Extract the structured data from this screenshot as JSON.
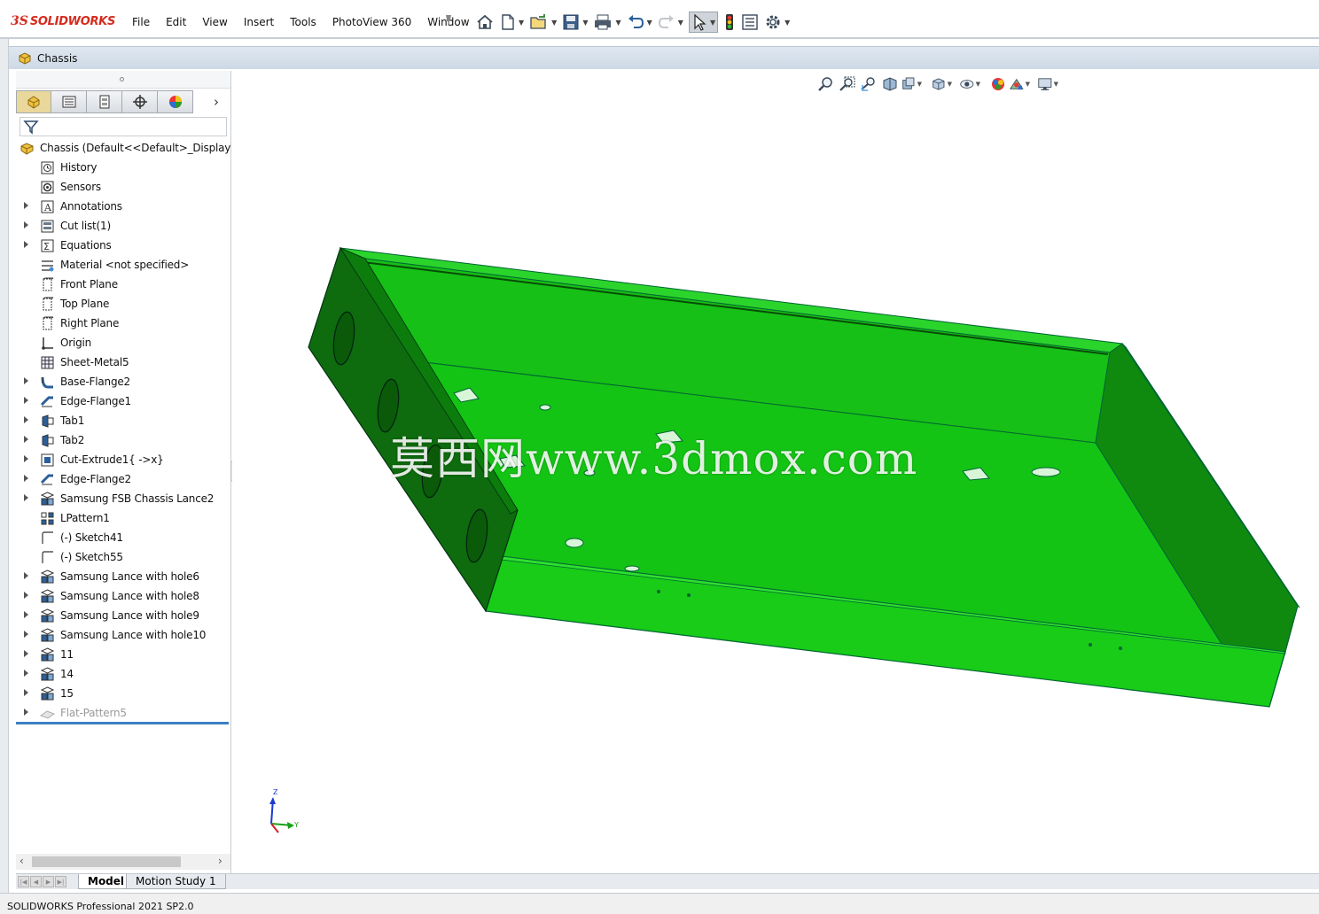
{
  "app": {
    "logo_ds": "3S",
    "logo_name": "SOLIDWORKS",
    "accent_red": "#d52b1e"
  },
  "menubar": {
    "items": [
      "File",
      "Edit",
      "View",
      "Insert",
      "Tools",
      "PhotoView 360",
      "Window"
    ],
    "pin_icon": "pin-icon"
  },
  "toolbar": {
    "icons": [
      "home-icon",
      "new-document-icon",
      "open-icon",
      "save-icon",
      "print-icon",
      "undo-icon",
      "redo-icon",
      "select-icon",
      "rebuild-icon",
      "file-properties-icon",
      "options-icon"
    ]
  },
  "document": {
    "title": "Chassis"
  },
  "feature_manager": {
    "tabs": [
      "featuremanager-tab",
      "propertymanager-tab",
      "configurationmanager-tab",
      "dimxpertmanager-tab",
      "displaymanager-tab"
    ],
    "root_label": "Chassis  (Default<<Default>_Display Stat",
    "items": [
      {
        "label": "History",
        "icon": "history-icon",
        "expand": false
      },
      {
        "label": "Sensors",
        "icon": "sensors-icon",
        "expand": false
      },
      {
        "label": "Annotations",
        "icon": "annotations-icon",
        "expand": true
      },
      {
        "label": "Cut list(1)",
        "icon": "cut-list-icon",
        "expand": true
      },
      {
        "label": "Equations",
        "icon": "equations-icon",
        "expand": true
      },
      {
        "label": "Material <not specified>",
        "icon": "material-icon",
        "expand": false
      },
      {
        "label": "Front Plane",
        "icon": "plane-icon",
        "expand": false
      },
      {
        "label": "Top Plane",
        "icon": "plane-icon",
        "expand": false
      },
      {
        "label": "Right Plane",
        "icon": "plane-icon",
        "expand": false
      },
      {
        "label": "Origin",
        "icon": "origin-icon",
        "expand": false
      },
      {
        "label": "Sheet-Metal5",
        "icon": "sheet-metal-icon",
        "expand": false
      },
      {
        "label": "Base-Flange2",
        "icon": "base-flange-icon",
        "expand": true
      },
      {
        "label": "Edge-Flange1",
        "icon": "edge-flange-icon",
        "expand": true
      },
      {
        "label": "Tab1",
        "icon": "tab-feature-icon",
        "expand": true
      },
      {
        "label": "Tab2",
        "icon": "tab-feature-icon",
        "expand": true
      },
      {
        "label": "Cut-Extrude1{ ->x}",
        "icon": "cut-extrude-icon",
        "expand": true
      },
      {
        "label": "Edge-Flange2",
        "icon": "edge-flange-icon",
        "expand": true
      },
      {
        "label": "Samsung FSB Chassis Lance2",
        "icon": "library-feature-icon",
        "expand": true
      },
      {
        "label": "LPattern1",
        "icon": "linear-pattern-icon",
        "expand": false
      },
      {
        "label": "(-) Sketch41",
        "icon": "sketch-icon",
        "expand": false
      },
      {
        "label": "(-) Sketch55",
        "icon": "sketch-icon",
        "expand": false
      },
      {
        "label": "Samsung Lance with hole6",
        "icon": "library-feature-icon",
        "expand": true
      },
      {
        "label": "Samsung Lance with hole8",
        "icon": "library-feature-icon",
        "expand": true
      },
      {
        "label": "Samsung Lance with hole9",
        "icon": "library-feature-icon",
        "expand": true
      },
      {
        "label": "Samsung Lance with hole10",
        "icon": "library-feature-icon",
        "expand": true
      },
      {
        "label": "11",
        "icon": "library-feature-icon",
        "expand": true
      },
      {
        "label": "14",
        "icon": "library-feature-icon",
        "expand": true
      },
      {
        "label": "15",
        "icon": "library-feature-icon",
        "expand": true
      },
      {
        "label": "Flat-Pattern5",
        "icon": "flat-pattern-icon",
        "expand": true,
        "suppressed": true
      }
    ]
  },
  "viewport": {
    "headsup_icons": [
      "zoom-to-fit-icon",
      "zoom-to-area-icon",
      "previous-view-icon",
      "section-view-icon",
      "dynamic-annotation-icon",
      "view-orientation-icon",
      "display-style-icon",
      "hide-show-items-icon",
      "edit-appearance-icon",
      "apply-scene-icon",
      "view-settings-icon"
    ],
    "watermark": "莫西网www.3dmox.com",
    "model_color": "#1bc81b",
    "triad": {
      "z": "Z",
      "y": "Y"
    }
  },
  "bottom_tabs": {
    "model": "Model",
    "motion": "Motion Study 1"
  },
  "status": {
    "text": "SOLIDWORKS Professional 2021 SP2.0"
  }
}
